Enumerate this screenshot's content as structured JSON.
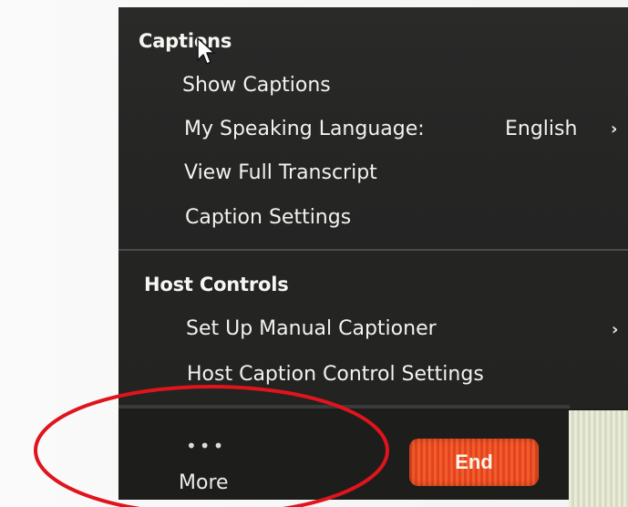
{
  "captions_menu": {
    "section_title": "Captions",
    "items": [
      {
        "label": "Show Captions"
      },
      {
        "label": "My Speaking Language:",
        "value": "English"
      },
      {
        "label": "View Full Transcript"
      },
      {
        "label": "Caption Settings"
      }
    ]
  },
  "host_controls_menu": {
    "section_title": "Host Controls",
    "items": [
      {
        "label": "Set Up Manual Captioner"
      },
      {
        "label": "Host Caption Control Settings"
      }
    ]
  },
  "toolbar": {
    "more_dots": "•••",
    "more_label": "More",
    "end_label": "End"
  },
  "colors": {
    "menu_background": "#252524",
    "end_button": "#e5431f",
    "annotation_circle": "#e0141c"
  },
  "icons": {
    "submenu": "chevron-right-icon",
    "cursor": "mouse-pointer-icon",
    "more": "ellipsis-icon"
  }
}
